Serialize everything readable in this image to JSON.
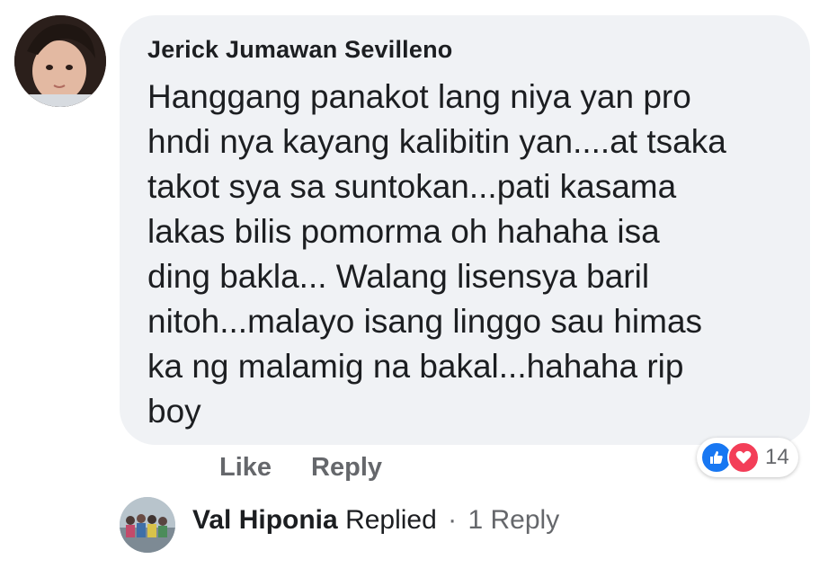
{
  "comment": {
    "author": "Jerick Jumawan Sevilleno",
    "lines": [
      "Hanggang panakot lang niya yan pro",
      "hndi nya kayang kalibitin yan....at tsaka",
      "takot sya sa suntokan...pati kasama",
      "lakas bilis pomorma oh hahaha isa",
      "ding bakla... Walang lisensya baril",
      "nitoh...malayo isang linggo sau himas",
      "ka ng malamig na bakal...hahaha rip",
      "boy"
    ]
  },
  "reactions": {
    "icons": [
      "like-icon",
      "love-icon"
    ],
    "count": "14"
  },
  "actions": {
    "like_label": "Like",
    "reply_label": "Reply"
  },
  "reply_summary": {
    "name": "Val Hiponia",
    "action": "Replied",
    "separator": "·",
    "count_label": "1 Reply"
  },
  "colors": {
    "bubble": "#f0f2f5",
    "text": "#1c1e21",
    "secondary": "#65676b",
    "like_blue": "#1877f2",
    "love_red": "#f33e58"
  }
}
